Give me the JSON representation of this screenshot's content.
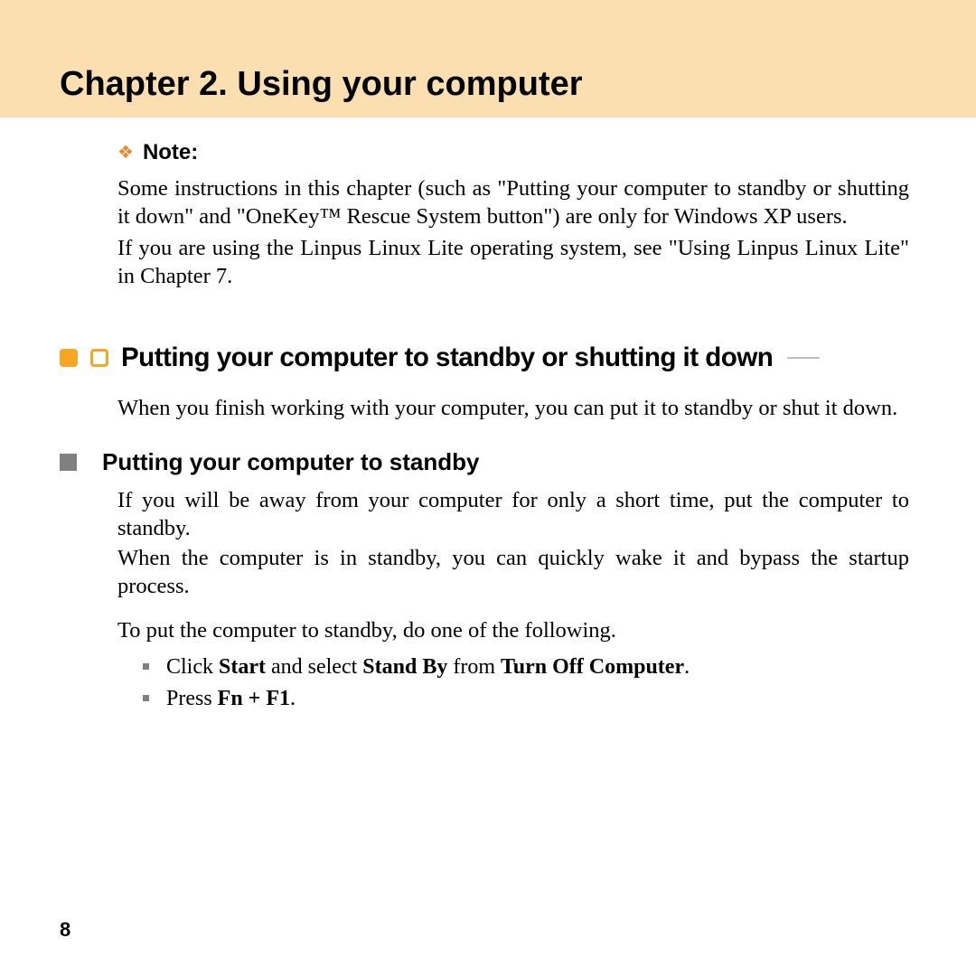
{
  "chapter": {
    "title": "Chapter 2. Using your computer"
  },
  "note": {
    "label": "Note:",
    "para1": "Some instructions in this chapter (such as \"Putting your computer to standby or shutting it down\" and \"OneKey™ Rescue System button\") are only for Windows XP users.",
    "para2": "If you are using the Linpus Linux Lite operating system, see \"Using Linpus Linux Lite\" in Chapter 7."
  },
  "section": {
    "title": "Putting your computer to standby or shutting it down",
    "intro": "When you finish working with your computer, you can put it to standby or shut it down."
  },
  "subsection": {
    "title": "Putting your computer to standby",
    "para1": "If you will be away from your computer for only a short time, put the computer to standby.",
    "para2": "When the computer is in standby, you can quickly wake it and bypass the startup process.",
    "para3": "To put the computer to standby, do one of the following.",
    "bullets": {
      "b1_pre": "Click ",
      "b1_bold1": "Start",
      "b1_mid1": " and select ",
      "b1_bold2": "Stand By",
      "b1_mid2": " from ",
      "b1_bold3": "Turn Off Computer",
      "b1_post": ".",
      "b2_pre": "Press ",
      "b2_bold": "Fn + F1",
      "b2_post": "."
    }
  },
  "page_number": "8"
}
